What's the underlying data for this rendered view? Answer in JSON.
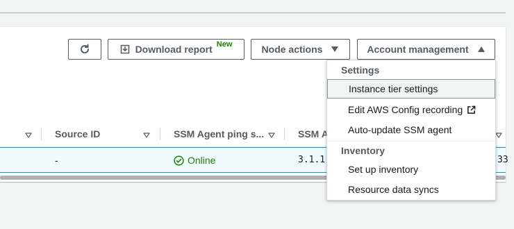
{
  "toolbar": {
    "refresh_icon": "refresh-icon",
    "download_label": "Download report",
    "download_badge": "New",
    "node_actions_label": "Node actions",
    "account_management_label": "Account management"
  },
  "table": {
    "columns": [
      {
        "label": "Source ID"
      },
      {
        "label": "SSM Agent ping s..."
      },
      {
        "label": "SSM Ag"
      }
    ],
    "row": {
      "source_id": "-",
      "ping_status": "Online",
      "agent_version": "3.1.1",
      "trailing_fragment": "33"
    }
  },
  "dropdown": {
    "settings_header": "Settings",
    "settings_items": [
      {
        "label": "Instance tier settings"
      },
      {
        "label": "Edit AWS Config recording"
      },
      {
        "label": "Auto-update SSM agent"
      }
    ],
    "inventory_header": "Inventory",
    "inventory_items": [
      {
        "label": "Set up inventory"
      },
      {
        "label": "Resource data syncs"
      }
    ]
  },
  "colors": {
    "online_green": "#1d8102",
    "selected_row_bg": "#f1faff",
    "selected_row_border": "#00a1c9",
    "button_border": "#545b64"
  }
}
